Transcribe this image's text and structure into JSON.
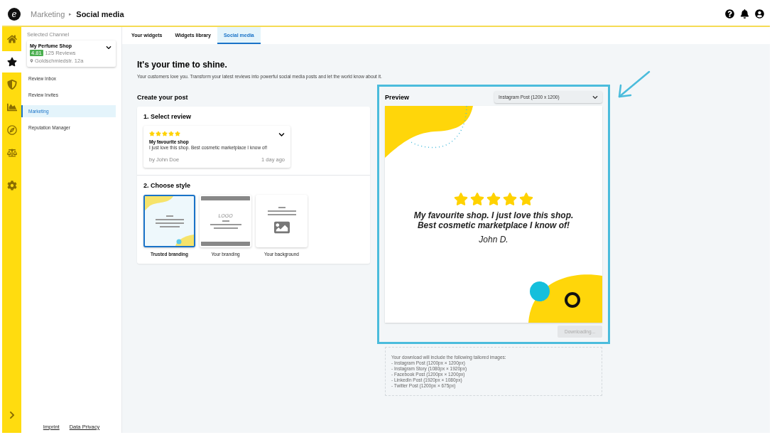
{
  "header": {
    "logo": "e",
    "breadcrumb": "Marketing",
    "separator": "▸",
    "current": "Social media"
  },
  "rail": [
    {
      "kind": "home",
      "selected": false
    },
    {
      "kind": "star",
      "selected": true
    },
    {
      "kind": "shield",
      "selected": false
    },
    {
      "kind": "chart",
      "selected": false
    },
    {
      "kind": "badge",
      "selected": false
    },
    {
      "kind": "scale",
      "selected": false
    },
    {
      "kind": "gear",
      "selected": false
    }
  ],
  "sidebar": {
    "channel_label": "Selected Channel",
    "channel": {
      "name": "My Perfume Shop",
      "score": "4.81",
      "reviews": "125 Reviews",
      "address": "Goldschmiedstr. 12a"
    },
    "items": [
      {
        "label": "Review Inbox",
        "selected": false
      },
      {
        "label": "Review Invites",
        "selected": false
      },
      {
        "label": "Marketing",
        "selected": true
      },
      {
        "label": "Reputation Manager",
        "selected": false
      }
    ],
    "footer_links": [
      "Imprint",
      "Data Privacy"
    ]
  },
  "tabs": [
    {
      "label": "Your widgets",
      "selected": false
    },
    {
      "label": "Widgets library",
      "selected": false
    },
    {
      "label": "Social media",
      "selected": true
    }
  ],
  "headline": "It's your time to shine.",
  "intro": "Your customers love you. Transform your latest reviews into powerful social media posts and let the world know about it.",
  "create_post": {
    "title": "Create your post",
    "select_review": {
      "title": "1. Select review",
      "review": {
        "stars": 5,
        "title": "My favourite shop",
        "text": "I just love this shop. Best cosmetic marketplace I know of!",
        "author": "by John Doe",
        "age": "1 day ago"
      }
    },
    "choose_style": {
      "title": "2. Choose style",
      "styles": [
        {
          "kind": "trusted",
          "label": "Trusted branding",
          "selected": true
        },
        {
          "kind": "logo",
          "label": "Your branding",
          "logo": "LOGO",
          "selected": false
        },
        {
          "kind": "background",
          "label": "Your background",
          "selected": false
        }
      ]
    }
  },
  "preview": {
    "title": "Preview",
    "format": "Instagram Post (1200 x 1200)",
    "post": {
      "stars": 5,
      "quote": "My favourite shop. I just love this shop. Best cosmetic marketplace I know of!",
      "author": "John D."
    },
    "download": {
      "label": "Downloading...",
      "disabled": true
    },
    "highlighted": true
  },
  "download_info": {
    "intro": "Your download will include the following tailored images:",
    "items": [
      "- Instagram Post (1200px × 1200px)",
      "- Instagram Story (1080px × 1920px)",
      "- Facebook Post (1200px × 1200px)",
      "- LinkedIn Post (1920px × 1080px)",
      "- Twitter Post (1200px × 675px)"
    ]
  }
}
